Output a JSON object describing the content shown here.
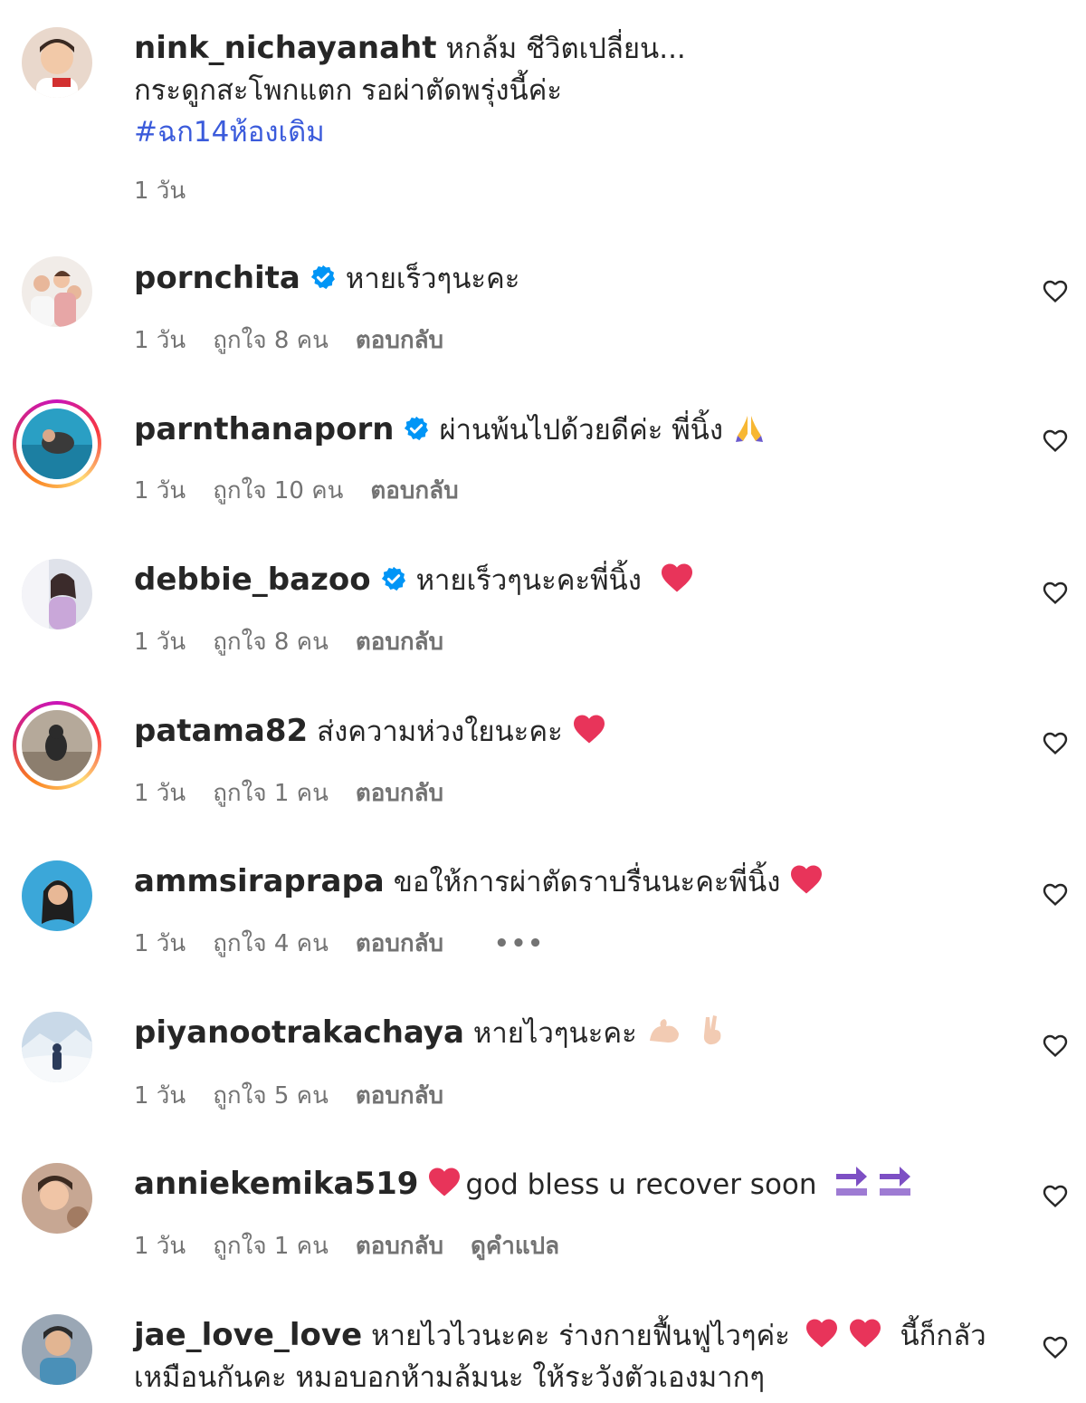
{
  "post": {
    "username": "nink_nichayanaht",
    "caption_line1": "หกล้ม ชีวิตเปลี่ยน...",
    "caption_line2": "กระดูกสะโพกแตก รอผ่าตัดพรุ่งนี้ค่ะ",
    "hashtag": "#ฉก14ห้องเดิม",
    "time": "1 วัน"
  },
  "comments": [
    {
      "username": "pornchita",
      "text": "หายเร็วๆนะคะ",
      "time": "1 วัน",
      "likes": "ถูกใจ 8 คน",
      "reply": "ตอบกลับ"
    },
    {
      "username": "parnthanaporn",
      "text": "ผ่านพ้นไปด้วยดีค่ะ พี่นิ้ง",
      "time": "1 วัน",
      "likes": "ถูกใจ 10 คน",
      "reply": "ตอบกลับ"
    },
    {
      "username": "debbie_bazoo",
      "text": "หายเร็วๆนะคะพี่นิ้ง",
      "time": "1 วัน",
      "likes": "ถูกใจ 8 คน",
      "reply": "ตอบกลับ"
    },
    {
      "username": "patama82",
      "text": "ส่งความห่วงใยนะคะ",
      "time": "1 วัน",
      "likes": "ถูกใจ 1 คน",
      "reply": "ตอบกลับ"
    },
    {
      "username": "ammsiraprapa",
      "text": "ขอให้การผ่าตัดราบรื่นนะคะพี่นิ้ง",
      "time": "1 วัน",
      "likes": "ถูกใจ 4 คน",
      "reply": "ตอบกลับ",
      "more": "•••"
    },
    {
      "username": "piyanootrakachaya",
      "text": "หายไวๆนะคะ",
      "time": "1 วัน",
      "likes": "ถูกใจ 5 คน",
      "reply": "ตอบกลับ"
    },
    {
      "username": "anniekemika519",
      "text": "god bless u recover soon",
      "time": "1 วัน",
      "likes": "ถูกใจ 1 คน",
      "reply": "ตอบกลับ",
      "translate": "ดูคำแปล"
    },
    {
      "username": "jae_love_love",
      "text": "หายไวไวนะคะ ร่างกายฟื้นฟูไวๆค่ะ",
      "text2": "นี้ก็กลัว",
      "text3": "เหมือนกันคะ หมอบอกห้ามล้มนะ ให้ระวังตัวเองมากๆ"
    }
  ],
  "icons": {
    "verified": "verified-badge-icon",
    "like": "heart-outline-icon",
    "emoji_heart": "red-heart-emoji",
    "emoji_pray": "folded-hands-emoji",
    "emoji_muscle": "flexed-biceps-emoji",
    "emoji_victory": "victory-hand-emoji",
    "emoji_soon": "soon-arrow-emoji"
  },
  "colors": {
    "verified": "#0095f6",
    "heart_emoji": "#e8345a",
    "muted": "#737373",
    "hashtag": "#3b5bdb",
    "soon": "#7d4fc4"
  }
}
